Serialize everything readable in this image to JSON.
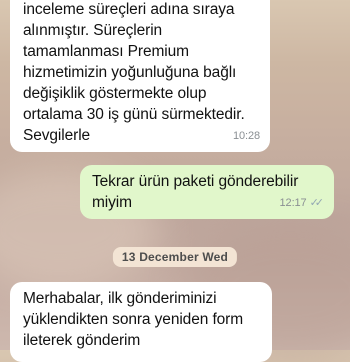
{
  "messages": [
    {
      "direction": "incoming",
      "text": "inceleme süreçleri adına sıraya\nalınmıştır. Süreçlerin\ntamamlanması Premium\nhizmetimizin yoğunluğuna bağlı\ndeğişiklik göstermekte olup\nortalama 30 iş günü sürmektedir.\nSevgilerle",
      "time": "10:28"
    },
    {
      "direction": "outgoing",
      "text": "Tekrar ürün paketi gönderebilir\nmiyim",
      "time": "12:17",
      "status": "read"
    },
    {
      "direction": "incoming",
      "text": "Merhabalar, ilk gönderiminizi\nyüklendikten sonra yeniden form\nileterek gönderim"
    }
  ],
  "date_separator": "13 December Wed",
  "colors": {
    "incoming_bubble": "#ffffff",
    "outgoing_bubble": "#e1f7cb",
    "timestamp": "#8a8f93",
    "date_pill": "#f3e4d4"
  }
}
